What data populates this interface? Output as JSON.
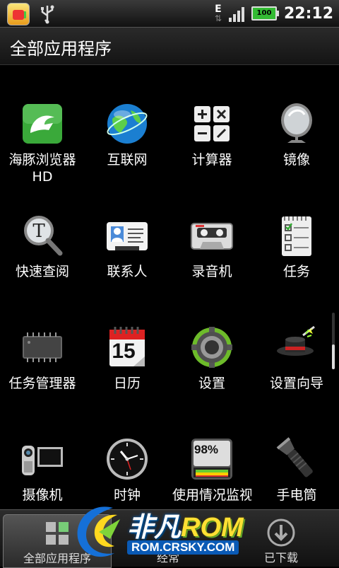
{
  "status_bar": {
    "time": "22:12",
    "battery": "100",
    "network_type": "E",
    "icons": [
      "market-icon",
      "usb-icon",
      "network-e-icon",
      "signal-icon",
      "battery-icon"
    ]
  },
  "title_bar": {
    "title": "全部应用程序"
  },
  "apps": [
    {
      "label": "海豚浏览器HD",
      "icon": "dolphin-browser-icon"
    },
    {
      "label": "互联网",
      "icon": "globe-icon"
    },
    {
      "label": "计算器",
      "icon": "calculator-icon"
    },
    {
      "label": "镜像",
      "icon": "mirror-icon"
    },
    {
      "label": "快速查阅",
      "icon": "magnifier-icon"
    },
    {
      "label": "联系人",
      "icon": "contact-card-icon"
    },
    {
      "label": "录音机",
      "icon": "cassette-icon"
    },
    {
      "label": "任务",
      "icon": "task-notepad-icon"
    },
    {
      "label": "任务管理器",
      "icon": "chip-icon"
    },
    {
      "label": "日历",
      "icon": "calendar-icon"
    },
    {
      "label": "设置",
      "icon": "gear-icon"
    },
    {
      "label": "设置向导",
      "icon": "magic-hat-icon"
    },
    {
      "label": "摄像机",
      "icon": "camcorder-icon"
    },
    {
      "label": "时钟",
      "icon": "clock-icon"
    },
    {
      "label": "使用情况监视器",
      "icon": "usage-meter-icon"
    },
    {
      "label": "手电筒",
      "icon": "flashlight-icon"
    }
  ],
  "calendar_day": "15",
  "usage_percent": "98%",
  "tabs": [
    {
      "label": "全部应用程序",
      "active": true
    },
    {
      "label": "经常",
      "active": false
    },
    {
      "label": "已下载",
      "active": false
    }
  ],
  "watermark": {
    "brand": "非凡",
    "brand_rom": "ROM",
    "url": "ROM.CRSKY.COM"
  }
}
